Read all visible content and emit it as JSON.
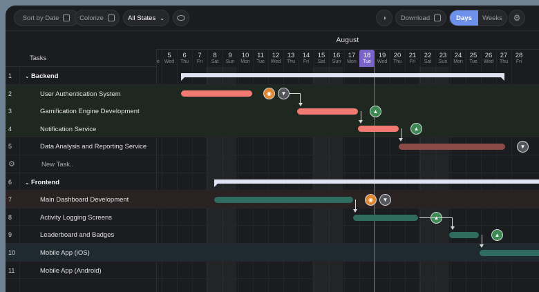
{
  "toolbar": {
    "sort_label": "Sort by Date",
    "colorize_label": "Colorize",
    "states_label": "All States",
    "download_label": "Download",
    "view_days": "Days",
    "view_weeks": "Weeks"
  },
  "timeline": {
    "month": "August",
    "today": "18",
    "days": [
      {
        "n": "5",
        "w": "Wed"
      },
      {
        "n": "6",
        "w": "Thu"
      },
      {
        "n": "7",
        "w": "Fri"
      },
      {
        "n": "8",
        "w": "Sat"
      },
      {
        "n": "9",
        "w": "Sun"
      },
      {
        "n": "10",
        "w": "Mon"
      },
      {
        "n": "11",
        "w": "Tue"
      },
      {
        "n": "12",
        "w": "Wed"
      },
      {
        "n": "13",
        "w": "Thu"
      },
      {
        "n": "14",
        "w": "Fri"
      },
      {
        "n": "15",
        "w": "Sat"
      },
      {
        "n": "16",
        "w": "Sun"
      },
      {
        "n": "17",
        "w": "Mon"
      },
      {
        "n": "18",
        "w": "Tue"
      },
      {
        "n": "19",
        "w": "Wed"
      },
      {
        "n": "20",
        "w": "Thu"
      },
      {
        "n": "21",
        "w": "Fri"
      },
      {
        "n": "22",
        "w": "Sat"
      },
      {
        "n": "23",
        "w": "Sun"
      },
      {
        "n": "24",
        "w": "Mon"
      },
      {
        "n": "25",
        "w": "Tue"
      },
      {
        "n": "26",
        "w": "Wed"
      },
      {
        "n": "27",
        "w": "Thu"
      },
      {
        "n": "28",
        "w": "Fri"
      }
    ]
  },
  "tasks_header": "Tasks",
  "rows": [
    {
      "num": "1",
      "label": "Backend"
    },
    {
      "num": "2",
      "label": "User Authentication System"
    },
    {
      "num": "3",
      "label": "Gamification Engine Development"
    },
    {
      "num": "4",
      "label": "Notification Service"
    },
    {
      "num": "5",
      "label": "Data Analysis and Reporting Service"
    },
    {
      "num": "",
      "label": "New Task.."
    },
    {
      "num": "6",
      "label": "Frontend"
    },
    {
      "num": "7",
      "label": "Main Dashboard Development"
    },
    {
      "num": "8",
      "label": "Activity Logging Screens"
    },
    {
      "num": "9",
      "label": "Leaderboard and Badges"
    },
    {
      "num": "10",
      "label": "Mobile App (iOS)"
    },
    {
      "num": "11",
      "label": "Mobile App (Android)"
    }
  ],
  "colors": {
    "backend_bar": "#f07a72",
    "backend_dim": "#8c4a47",
    "frontend_bar": "#2f6b5f",
    "today": "#7a64c9",
    "accent": "#6d91ea"
  }
}
